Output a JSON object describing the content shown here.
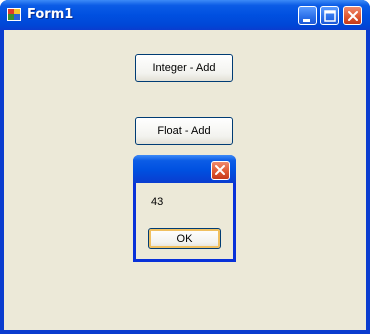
{
  "window": {
    "title": "Form1"
  },
  "buttons": {
    "integer_add": "Integer - Add",
    "float_add": "Float - Add"
  },
  "message_box": {
    "text": "43",
    "ok_label": "OK"
  },
  "colors": {
    "titlebar": "#0050e0",
    "client": "#ece9d8",
    "close": "#e05a32"
  }
}
